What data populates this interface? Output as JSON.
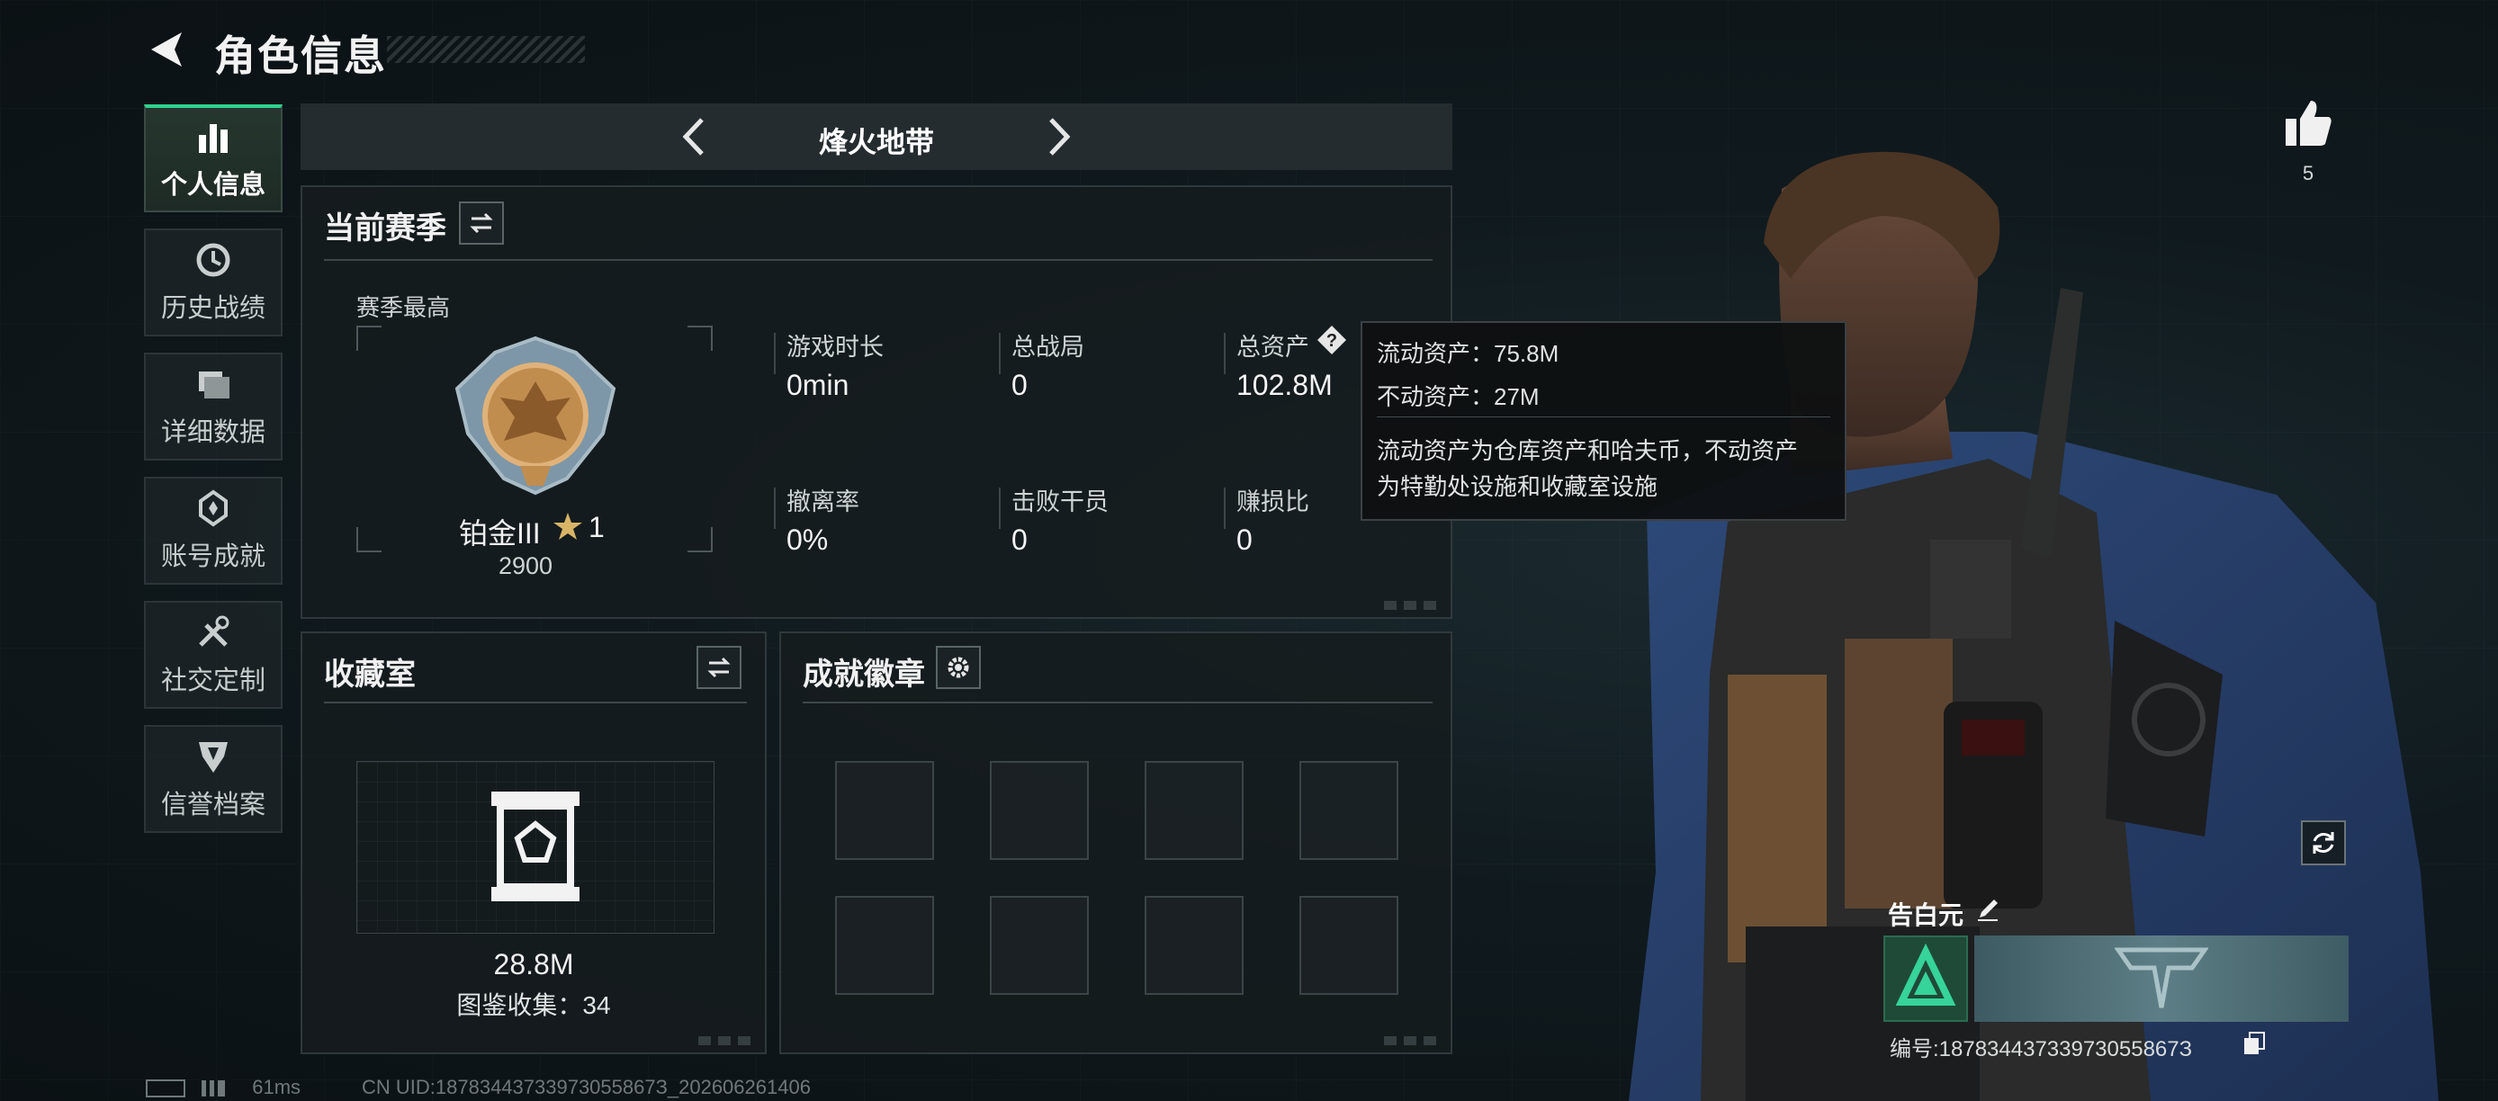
{
  "header": {
    "title": "角色信息"
  },
  "nav": {
    "items": [
      {
        "label": "个人信息",
        "icon": "bar-chart-icon",
        "active": true
      },
      {
        "label": "历史战绩",
        "icon": "clock-icon"
      },
      {
        "label": "详细数据",
        "icon": "folder-icon"
      },
      {
        "label": "账号成就",
        "icon": "achievement-icon"
      },
      {
        "label": "社交定制",
        "icon": "tools-icon"
      },
      {
        "label": "信誉档案",
        "icon": "shield-emblem-icon"
      }
    ]
  },
  "mode": {
    "title": "烽火地带"
  },
  "season": {
    "title": "当前赛季",
    "best_label": "赛季最高",
    "rank_name": "铂金III",
    "rank_stars": "1",
    "rank_score": "2900",
    "stats": [
      {
        "label": "游戏时长",
        "value": "0min"
      },
      {
        "label": "总战局",
        "value": "0"
      },
      {
        "label": "总资产",
        "value": "102.8M"
      },
      {
        "label": "撤离率",
        "value": "0%"
      },
      {
        "label": "击败干员",
        "value": "0"
      },
      {
        "label": "赚损比",
        "value": "0"
      }
    ]
  },
  "tooltip": {
    "line1": "流动资产：75.8M",
    "line2": "不动资产：27M",
    "desc1": "流动资产为仓库资产和哈夫币，不动资产",
    "desc2": "为特勤处设施和收藏室设施"
  },
  "collection": {
    "title": "收藏室",
    "value": "28.8M",
    "count_text": "图鉴收集：34"
  },
  "achievements": {
    "title": "成就徽章",
    "slots": 8
  },
  "profile": {
    "likes": "5",
    "name": "告白元",
    "uid_text": "编号:18783443733973055867З"
  },
  "status": {
    "ping": "61ms",
    "cn_uid": "CN UID:18783443733973055867З_202606261406"
  },
  "colors": {
    "accent": "#2fd18e",
    "panel": "#161c1f",
    "tooltip_bg": "#0e1011"
  }
}
